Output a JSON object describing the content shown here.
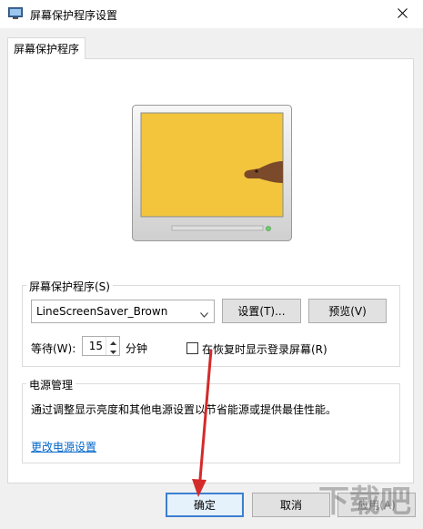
{
  "window": {
    "title": "屏幕保护程序设置",
    "close_label": "×"
  },
  "tab": {
    "label": "屏幕保护程序"
  },
  "screensaver": {
    "group_label": "屏幕保护程序(S)",
    "selected": "LineScreenSaver_Brown",
    "settings_button": "设置(T)...",
    "preview_button": "预览(V)",
    "wait_label": "等待(W):",
    "wait_value": "15",
    "wait_unit": "分钟",
    "resume_checkbox_label": "在恢复时显示登录屏幕(R)",
    "resume_checked": false
  },
  "power": {
    "group_label": "电源管理",
    "description": "通过调整显示亮度和其他电源设置以节省能源或提供最佳性能。",
    "link": "更改电源设置"
  },
  "footer": {
    "ok": "确定",
    "cancel": "取消",
    "apply": "应用(A)"
  },
  "colors": {
    "screen_yellow": "#f2c53d",
    "link_blue": "#0066cc",
    "arrow_red": "#d42a2a",
    "focus_blue": "#3c7fd1"
  },
  "watermark": "下载吧"
}
